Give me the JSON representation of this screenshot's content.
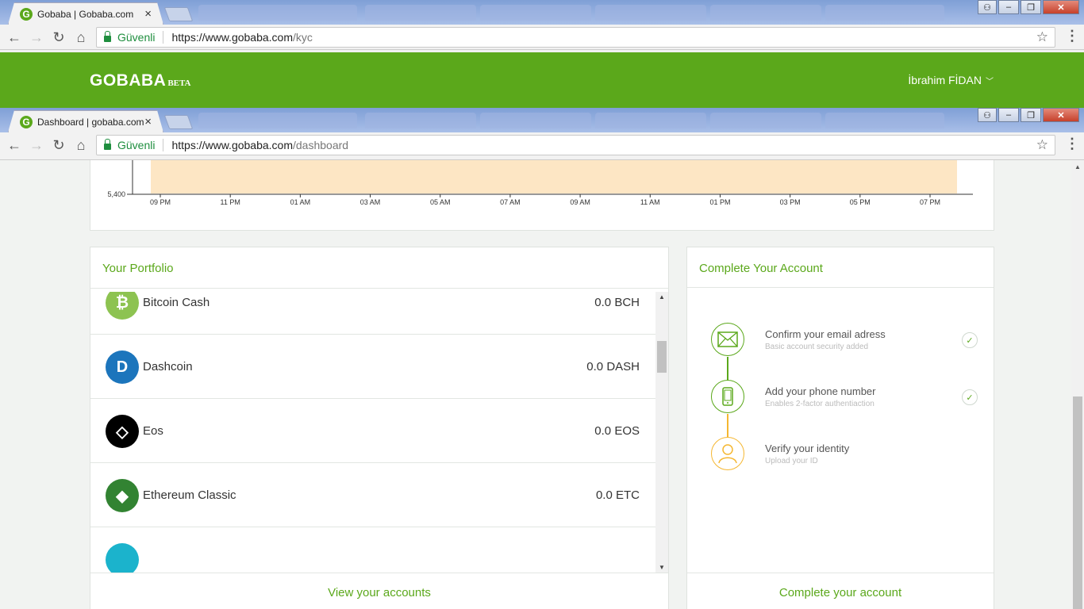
{
  "browser_top": {
    "tab_title": "Gobaba | Gobaba.com",
    "secure_label": "Güvenli",
    "url_base": "https://www.gobaba.com",
    "url_path": "/kyc"
  },
  "browser_bottom": {
    "tab_title": "Dashboard | gobaba.com",
    "secure_label": "Güvenli",
    "url_base": "https://www.gobaba.com",
    "url_path": "/dashboard"
  },
  "header": {
    "logo": "GOBABA",
    "logo_badge": "BETA",
    "user_name": "İbrahim FİDAN"
  },
  "chart_data": {
    "type": "area",
    "y_tick_labels": [
      "5,400"
    ],
    "x_tick_labels": [
      "09 PM",
      "11 PM",
      "01 AM",
      "03 AM",
      "05 AM",
      "07 AM",
      "09 AM",
      "11 AM",
      "01 PM",
      "03 PM",
      "05 PM",
      "07 PM"
    ],
    "fill_color": "#fde6c4",
    "axis_color": "#333333"
  },
  "portfolio": {
    "title": "Your Portfolio",
    "footer_link": "View your accounts",
    "coins": [
      {
        "name": "Bitcoin Cash",
        "balance": "0.0 BCH",
        "icon": "bitcoin-cash-icon",
        "color": "#8dc351",
        "glyph": "₿"
      },
      {
        "name": "Dashcoin",
        "balance": "0.0 DASH",
        "icon": "dash-icon",
        "color": "#1c75bc",
        "glyph": "D"
      },
      {
        "name": "Eos",
        "balance": "0.0 EOS",
        "icon": "eos-icon",
        "color": "#000000",
        "glyph": "◇"
      },
      {
        "name": "Ethereum Classic",
        "balance": "0.0 ETC",
        "icon": "ethereum-classic-icon",
        "color": "#328332",
        "glyph": "◆"
      },
      {
        "name": "",
        "balance": "",
        "icon": "partial-coin-icon",
        "color": "#1bb3cc",
        "glyph": ""
      }
    ]
  },
  "complete_account": {
    "title": "Complete Your Account",
    "footer_link": "Complete your account",
    "steps": [
      {
        "title": "Confirm your email adress",
        "subtitle": "Basic account security added",
        "done": true,
        "icon": "envelope-icon"
      },
      {
        "title": "Add your phone number",
        "subtitle": "Enables 2-factor authentiaction",
        "done": true,
        "icon": "phone-icon"
      },
      {
        "title": "Verify your identity",
        "subtitle": "Upload your ID",
        "done": false,
        "icon": "user-icon"
      }
    ]
  },
  "colors": {
    "brand_green": "#5ba81b",
    "pending_orange": "#f5b731"
  }
}
